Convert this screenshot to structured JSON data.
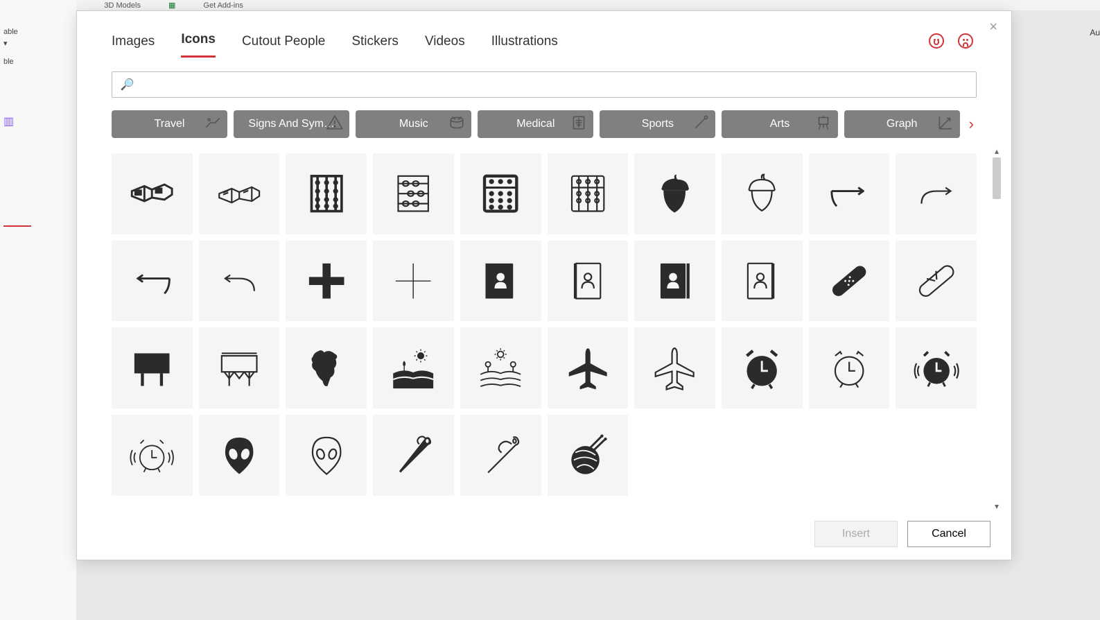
{
  "bg": {
    "models": "3D Models",
    "addins": "Get Add-ins",
    "left1": "able",
    "left2": "ble",
    "rightTxt": "Au"
  },
  "dialog": {
    "closeLabel": "×",
    "tabs": [
      "Images",
      "Icons",
      "Cutout People",
      "Stickers",
      "Videos",
      "Illustrations"
    ],
    "activeTab": 1,
    "searchPlaceholder": "",
    "categories": [
      "Travel",
      "Signs And Sym…",
      "Music",
      "Medical",
      "Sports",
      "Arts",
      "Graph"
    ],
    "nextCatGlyph": "›",
    "scrollUp": "▴",
    "scrollDown": "▾",
    "icons": [
      "3d-glasses-solid",
      "3d-glasses-outline",
      "abacus-1",
      "abacus-2",
      "abacus-3",
      "abacus-4",
      "acorn-solid",
      "acorn-outline",
      "arrow-curve-right",
      "",
      "arrow-curve-right-2",
      "arrow-curve-left",
      "arrow-curve-left-2",
      "plus-bold",
      "plus-thin",
      "address-book-solid",
      "address-book-outline",
      "address-book-solid-2",
      "address-book-outline-2",
      "",
      "bandage-solid",
      "bandage-outline",
      "billboard-solid",
      "billboard-outline",
      "africa",
      "farm-solid",
      "farm-outline",
      "airplane-solid",
      "airplane-outline",
      "",
      "alarm-solid",
      "alarm-outline",
      "alarm-ringing-solid",
      "alarm-ringing-outline",
      "alien-solid",
      "alien-outline",
      "needle-solid",
      "needle-outline",
      "yarn-ball",
      ""
    ],
    "insertLabel": "Insert",
    "cancelLabel": "Cancel"
  }
}
